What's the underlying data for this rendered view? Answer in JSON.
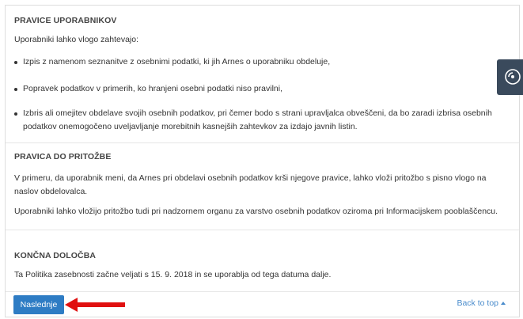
{
  "sections": {
    "rights": {
      "title": "PRAVICE UPORABNIKOV",
      "intro": "Uporabniki lahko vlogo zahtevajo:",
      "bullets": [
        "Izpis z namenom seznanitve z osebnimi podatki, ki jih Arnes o uporabniku obdeluje,",
        "Popravek podatkov v primerih, ko hranjeni osebni podatki niso pravilni,",
        "Izbris ali omejitev obdelave svojih osebnih podatkov, pri čemer bodo s strani upravljalca obveščeni, da bo zaradi izbrisa osebnih podatkov onemogočeno uveljavljanje morebitnih kasnejših zahtevkov za izdajo javnih listin."
      ]
    },
    "appeal": {
      "title": "PRAVICA DO PRITOŽBE",
      "para1": "V primeru, da uporabnik meni, da Arnes pri obdelavi osebnih podatkov krši njegove pravice, lahko vloži pritožbo s pisno vlogo na naslov obdelovalca.",
      "para2": "Uporabniki lahko vložijo pritožbo tudi pri nadzornem organu za varstvo osebnih podatkov oziroma pri Informacijskem pooblaščencu."
    },
    "final": {
      "title": "KONČNA DOLOČBA",
      "para": "Ta Politika zasebnosti začne veljati s 15. 9. 2018 in se uporablja od tega datuma dalje."
    }
  },
  "footer": {
    "next_label": "Naslednje",
    "back_to_top_label": "Back to top"
  },
  "icons": {
    "side_widget": "radio-signal-icon",
    "annotation": "red-arrow-icon"
  },
  "colors": {
    "button_bg": "#2e7cc4",
    "link": "#4a8ccc",
    "arrow": "#e01010",
    "widget_bg": "#3a4a5c"
  }
}
